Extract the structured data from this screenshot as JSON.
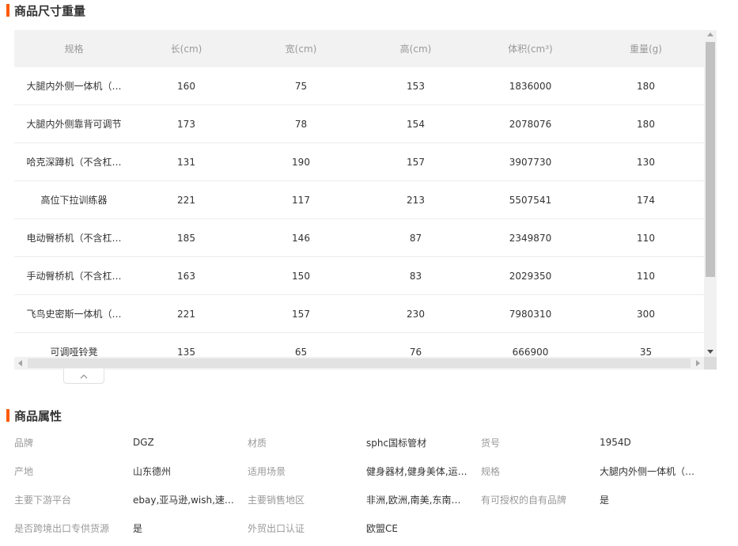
{
  "dimensions": {
    "title": "商品尺寸重量",
    "headers": [
      "规格",
      "长(cm)",
      "宽(cm)",
      "高(cm)",
      "体积(cm³)",
      "重量(g)"
    ],
    "rows": [
      [
        "大腿内外侧一体机（…",
        "160",
        "75",
        "153",
        "1836000",
        "180"
      ],
      [
        "大腿内外侧靠背可调节",
        "173",
        "78",
        "154",
        "2078076",
        "180"
      ],
      [
        "哈克深蹲机（不含杠…",
        "131",
        "190",
        "157",
        "3907730",
        "130"
      ],
      [
        "高位下拉训练器",
        "221",
        "117",
        "213",
        "5507541",
        "174"
      ],
      [
        "电动臀桥机（不含杠…",
        "185",
        "146",
        "87",
        "2349870",
        "110"
      ],
      [
        "手动臀桥机（不含杠…",
        "163",
        "150",
        "83",
        "2029350",
        "110"
      ],
      [
        "飞鸟史密斯一体机（…",
        "221",
        "157",
        "230",
        "7980310",
        "300"
      ],
      [
        "可调哑铃凳",
        "135",
        "65",
        "76",
        "666900",
        "35"
      ]
    ]
  },
  "attributes": {
    "title": "商品属性",
    "rows": [
      [
        {
          "label": "品牌",
          "value": "DGZ"
        },
        {
          "label": "材质",
          "value": "sphc国标管材"
        },
        {
          "label": "货号",
          "value": "1954D"
        }
      ],
      [
        {
          "label": "产地",
          "value": "山东德州"
        },
        {
          "label": "适用场景",
          "value": "健身器材,健身美体,运…"
        },
        {
          "label": "规格",
          "value": "大腿内外侧一体机（…"
        }
      ],
      [
        {
          "label": "主要下游平台",
          "value": "ebay,亚马逊,wish,速…"
        },
        {
          "label": "主要销售地区",
          "value": "非洲,欧洲,南美,东南…"
        },
        {
          "label": "有可授权的自有品牌",
          "value": "是"
        }
      ],
      [
        {
          "label": "是否跨境出口专供货源",
          "value": "是"
        },
        {
          "label": "外贸出口认证",
          "value": "欧盟CE"
        }
      ]
    ]
  },
  "colors": {
    "accent": "#ff5a00",
    "header_bg": "#f2f2f2",
    "label_text": "#999999",
    "body_text": "#333333"
  },
  "icons": {
    "collapse": "chevron-up-icon"
  }
}
